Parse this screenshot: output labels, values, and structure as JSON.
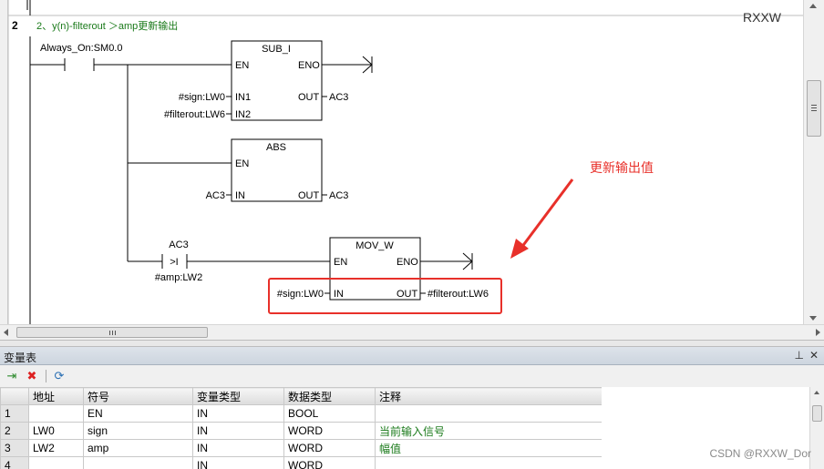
{
  "editor": {
    "network_number": "2",
    "network_comment": "2、y(n)-filterout ＞amp更新输出",
    "corner_label": "RXXW",
    "annotation": "更新输出值",
    "contact1_label": "Always_On:SM0.0",
    "sub_block": {
      "title": "SUB_I",
      "en": "EN",
      "eno": "ENO",
      "in1": "IN1",
      "in2": "IN2",
      "out": "OUT",
      "in1_val": "#sign:LW0",
      "in2_val": "#filterout:LW6",
      "out_val": "AC3"
    },
    "abs_block": {
      "title": "ABS",
      "en": "EN",
      "in": "IN",
      "out": "OUT",
      "in_val": "AC3",
      "out_val": "AC3"
    },
    "compare": {
      "top": "AC3",
      "op": ">I",
      "bottom": "#amp:LW2"
    },
    "mov_block": {
      "title": "MOV_W",
      "en": "EN",
      "eno": "ENO",
      "in": "IN",
      "out": "OUT",
      "in_val": "#sign:LW0",
      "out_val": "#filterout:LW6"
    },
    "colors": {
      "comment": "#1a7a1a",
      "annotation": "#e8302a",
      "highlight": "#e8302a"
    }
  },
  "var_table": {
    "title": "变量表",
    "pin_icon": "pin-icon",
    "close_icon": "close-icon",
    "headers": [
      "",
      "地址",
      "符号",
      "变量类型",
      "数据类型",
      "注释"
    ],
    "rows": [
      {
        "num": "1",
        "addr": "",
        "symbol": "EN",
        "var_type": "IN",
        "data_type": "BOOL",
        "comment": ""
      },
      {
        "num": "2",
        "addr": "LW0",
        "symbol": "sign",
        "var_type": "IN",
        "data_type": "WORD",
        "comment": "当前输入信号"
      },
      {
        "num": "3",
        "addr": "LW2",
        "symbol": "amp",
        "var_type": "IN",
        "data_type": "WORD",
        "comment": "幅值"
      },
      {
        "num": "4",
        "addr": "",
        "symbol": "",
        "var_type": "IN",
        "data_type": "WORD",
        "comment": ""
      }
    ]
  },
  "watermark": "CSDN @RXXW_Dor"
}
